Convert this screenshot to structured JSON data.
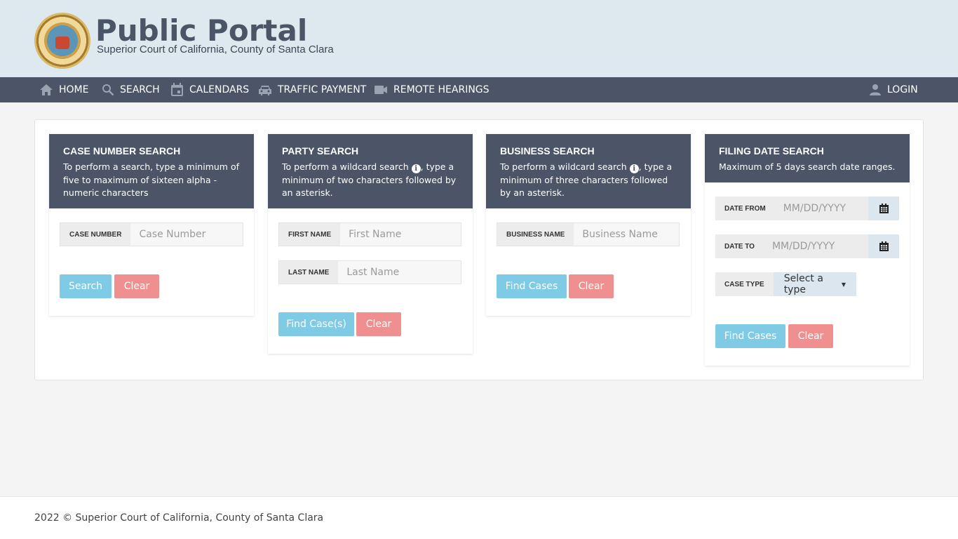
{
  "header": {
    "title": "Public Portal",
    "subtitle": "Superior Court of California, County of Santa Clara"
  },
  "nav": {
    "items": [
      {
        "label": "HOME",
        "icon": "home-icon"
      },
      {
        "label": "SEARCH",
        "icon": "search-icon"
      },
      {
        "label": "CALENDARS",
        "icon": "calendar-icon"
      },
      {
        "label": "TRAFFIC PAYMENT",
        "icon": "car-icon"
      },
      {
        "label": "REMOTE HEARINGS",
        "icon": "video-camera-icon"
      }
    ],
    "login": {
      "label": "LOGIN",
      "icon": "user-icon"
    }
  },
  "cards": {
    "case_number": {
      "title": "CASE NUMBER SEARCH",
      "desc": "To perform a search, type a minimum of five to maximum of sixteen alpha - numeric characters",
      "field_label": "CASE NUMBER",
      "field_placeholder": "Case Number",
      "search_label": "Search",
      "clear_label": "Clear"
    },
    "party": {
      "title": "PARTY SEARCH",
      "desc_pre": "To perform a wildcard search",
      "desc_post": ", type a minimum of two characters followed by an asterisk.",
      "first_label": "FIRST NAME",
      "first_placeholder": "First Name",
      "last_label": "LAST NAME",
      "last_placeholder": "Last Name",
      "find_label": "Find Case(s)",
      "clear_label": "Clear"
    },
    "business": {
      "title": "BUSINESS SEARCH",
      "desc_pre": "To perform a wildcard search",
      "desc_post": ", type a minimum of three characters followed by an asterisk.",
      "field_label": "BUSINESS NAME",
      "field_placeholder": "Business Name",
      "find_label": "Find Cases",
      "clear_label": "Clear"
    },
    "filing_date": {
      "title": "FILING DATE SEARCH",
      "desc": "Maximum of 5 days search date ranges.",
      "from_label": "DATE FROM",
      "from_placeholder": "MM/DD/YYYY",
      "to_label": "DATE TO",
      "to_placeholder": "MM/DD/YYYY",
      "case_type_label": "CASE TYPE",
      "case_type_value": "Select a type",
      "find_label": "Find Cases",
      "clear_label": "Clear"
    }
  },
  "footer": {
    "text": "2022 © Superior Court of California, County of Santa Clara"
  },
  "colors": {
    "nav_bg": "#4b5567",
    "header_bg": "#dde8ef",
    "btn_blue": "#7fcbe6",
    "btn_red": "#ef8f8f"
  }
}
